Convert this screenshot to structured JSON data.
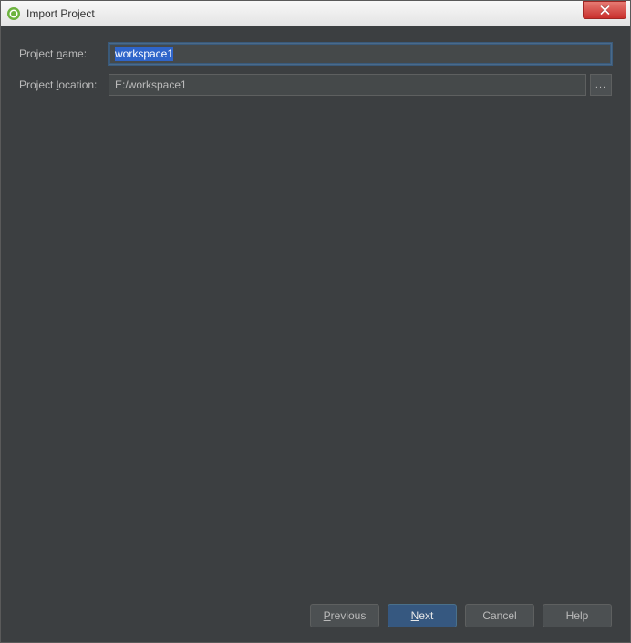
{
  "window": {
    "title": "Import Project"
  },
  "form": {
    "projectName": {
      "label_pre": "Project ",
      "label_mn": "n",
      "label_post": "ame:",
      "value": "workspace1"
    },
    "projectLocation": {
      "label_pre": "Project ",
      "label_mn": "l",
      "label_post": "ocation:",
      "value": "E:/workspace1",
      "browse": "..."
    }
  },
  "buttons": {
    "previous_mn": "P",
    "previous_post": "revious",
    "next_mn": "N",
    "next_post": "ext",
    "cancel": "Cancel",
    "help": "Help"
  }
}
